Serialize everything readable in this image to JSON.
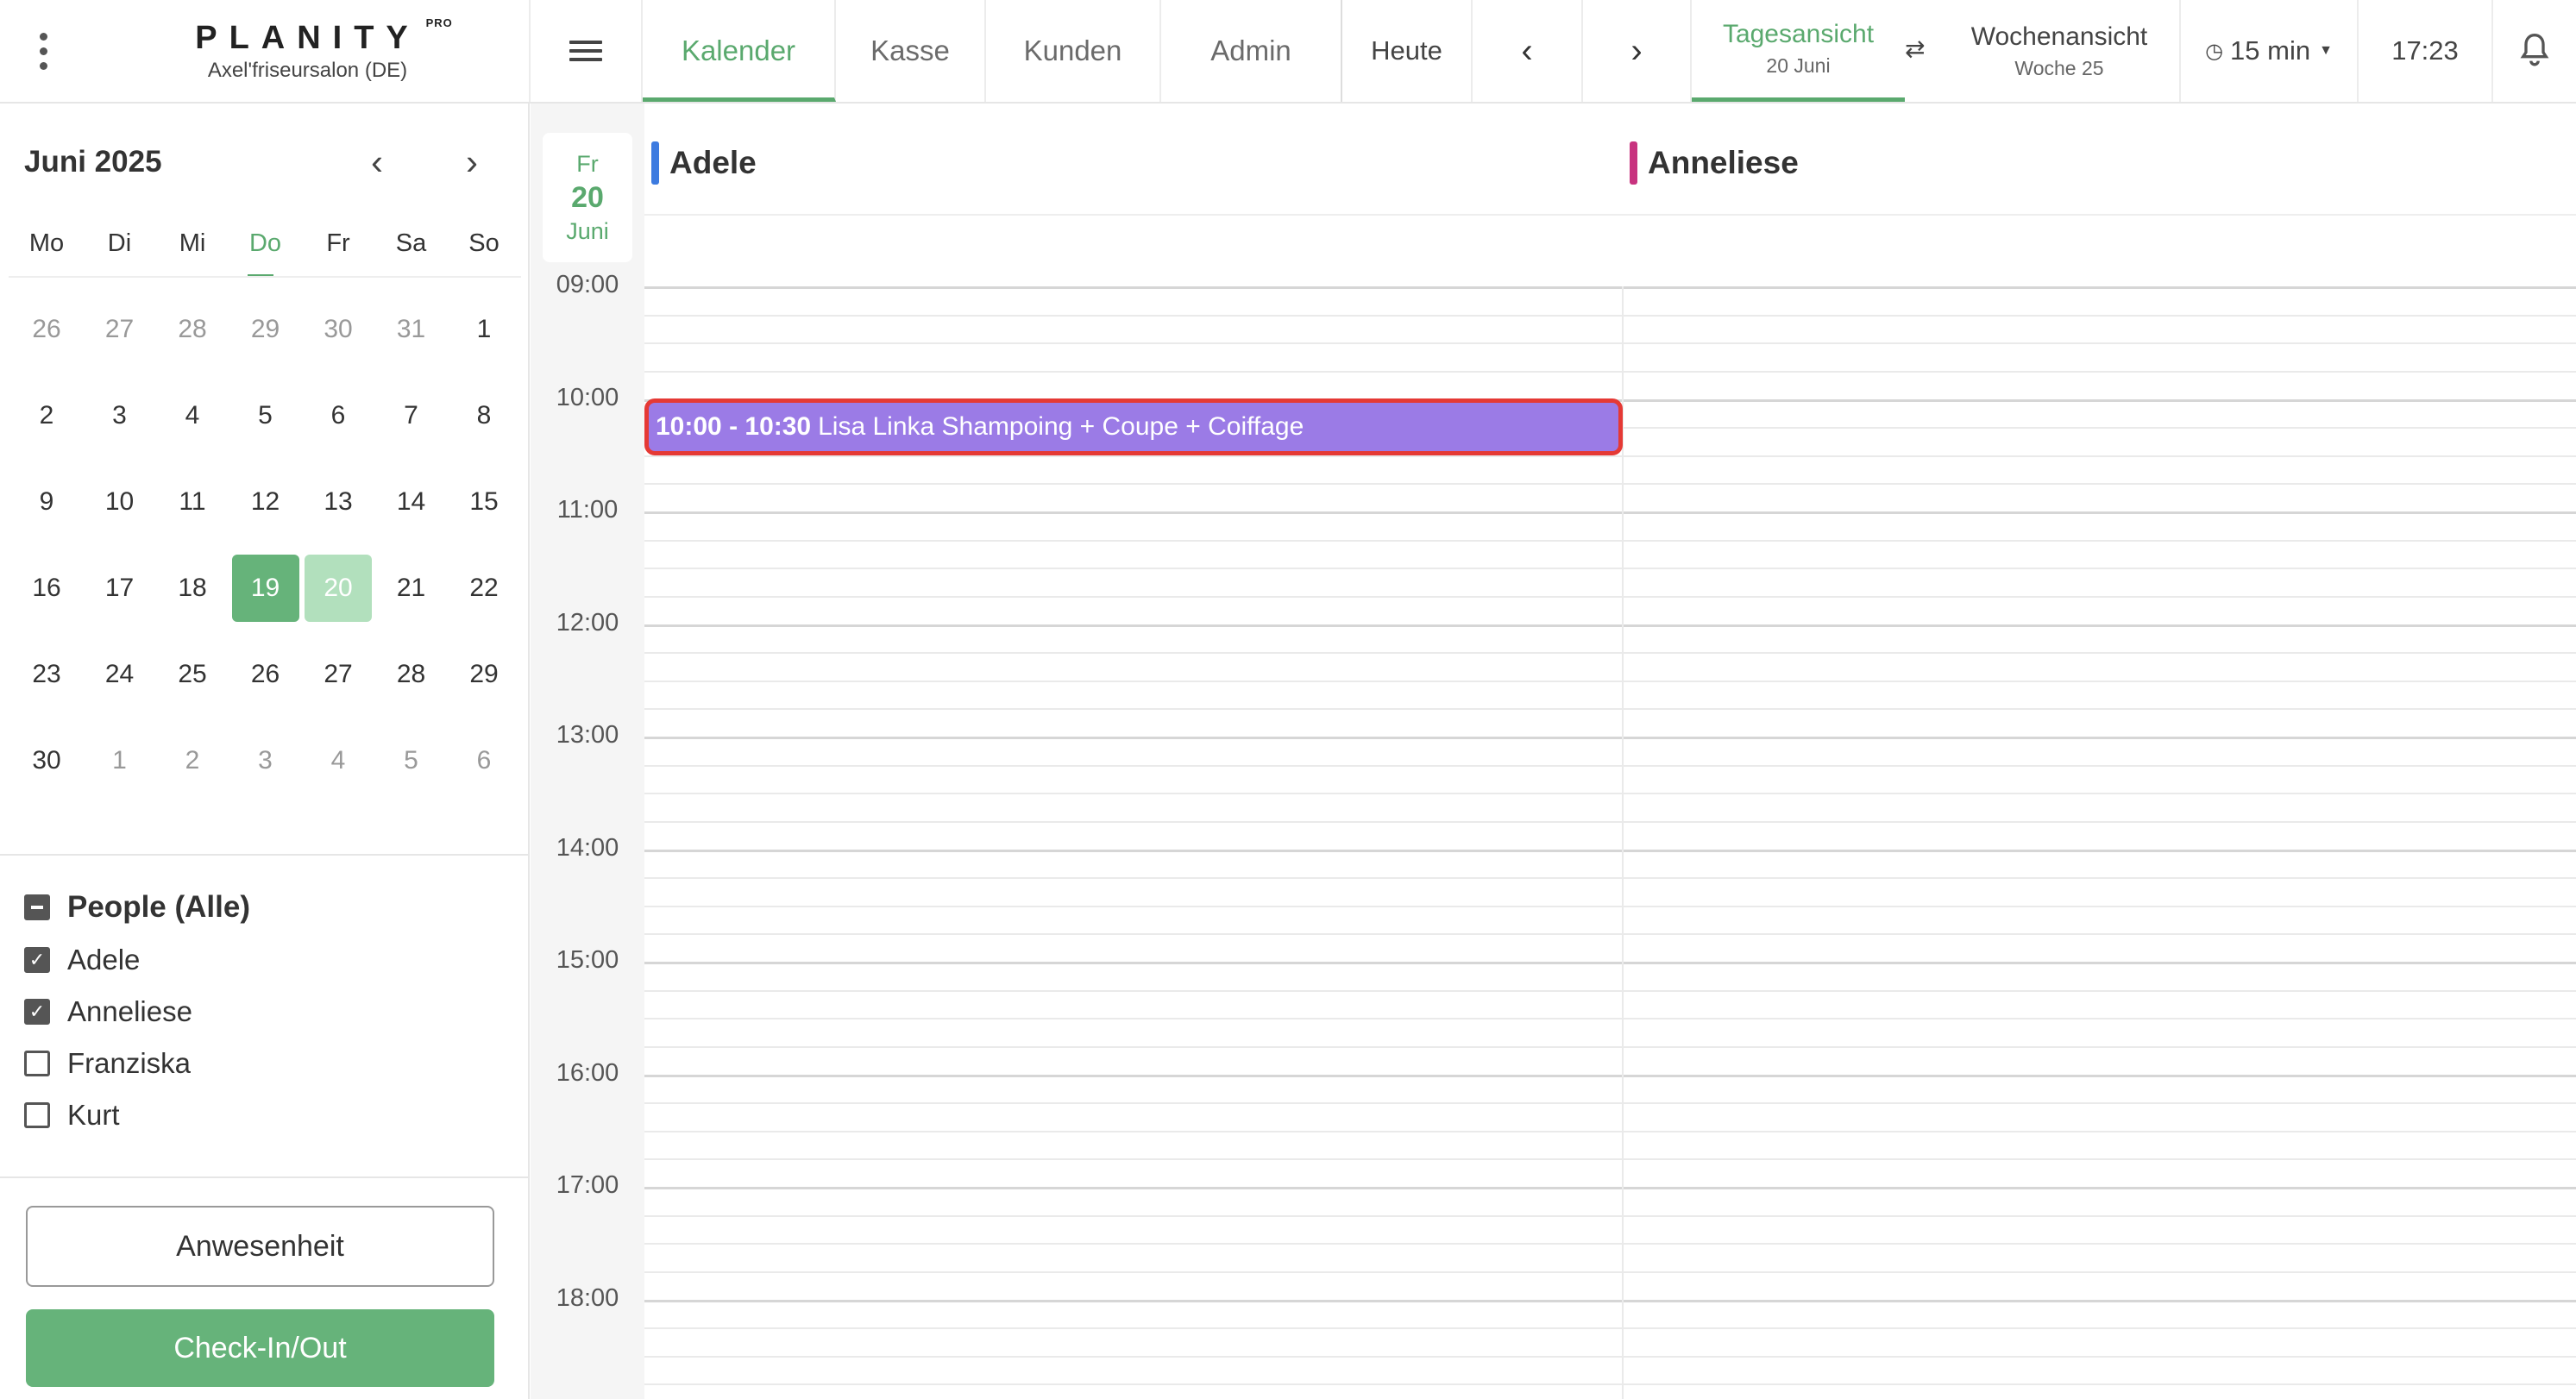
{
  "brand": {
    "logo": "PLANITY",
    "pro": "PRO",
    "salon": "Axel'friseursalon (DE)"
  },
  "nav": {
    "tabs": [
      "Kalender",
      "Kasse",
      "Kunden",
      "Admin"
    ],
    "today_label": "Heute"
  },
  "views": {
    "day": {
      "label": "Tagesansicht",
      "sub": "20 Juni"
    },
    "week": {
      "label": "Wochenansicht",
      "sub": "Woche 25"
    }
  },
  "interval": "15 min",
  "clock": "17:23",
  "mini_calendar": {
    "month": "Juni 2025",
    "weekdays": [
      "Mo",
      "Di",
      "Mi",
      "Do",
      "Fr",
      "Sa",
      "So"
    ],
    "weeks": [
      [
        "26",
        "27",
        "28",
        "29",
        "30",
        "31",
        "1"
      ],
      [
        "2",
        "3",
        "4",
        "5",
        "6",
        "7",
        "8"
      ],
      [
        "9",
        "10",
        "11",
        "12",
        "13",
        "14",
        "15"
      ],
      [
        "16",
        "17",
        "18",
        "19",
        "20",
        "21",
        "22"
      ],
      [
        "23",
        "24",
        "25",
        "26",
        "27",
        "28",
        "29"
      ],
      [
        "30",
        "1",
        "2",
        "3",
        "4",
        "5",
        "6"
      ]
    ]
  },
  "people": {
    "title": "People (Alle)",
    "list": [
      {
        "name": "Adele",
        "checked": true
      },
      {
        "name": "Anneliese",
        "checked": true
      },
      {
        "name": "Franziska",
        "checked": false
      },
      {
        "name": "Kurt",
        "checked": false
      }
    ]
  },
  "buttons": {
    "attendance": "Anwesenheit",
    "checkin": "Check-In/Out"
  },
  "selected_date": {
    "weekday": "Fr",
    "day": "20",
    "month": "Juni"
  },
  "staff_columns": [
    {
      "name": "Adele",
      "color": "#3d7be0"
    },
    {
      "name": "Anneliese",
      "color": "#c8337f"
    }
  ],
  "hours": [
    "09:00",
    "10:00",
    "11:00",
    "12:00",
    "13:00",
    "14:00",
    "15:00",
    "16:00",
    "17:00",
    "18:00"
  ],
  "appointment": {
    "time": "10:00 - 10:30",
    "text": "Lisa Linka Shampoing + Coupe + Coiffage",
    "color": "#9b7be6"
  }
}
